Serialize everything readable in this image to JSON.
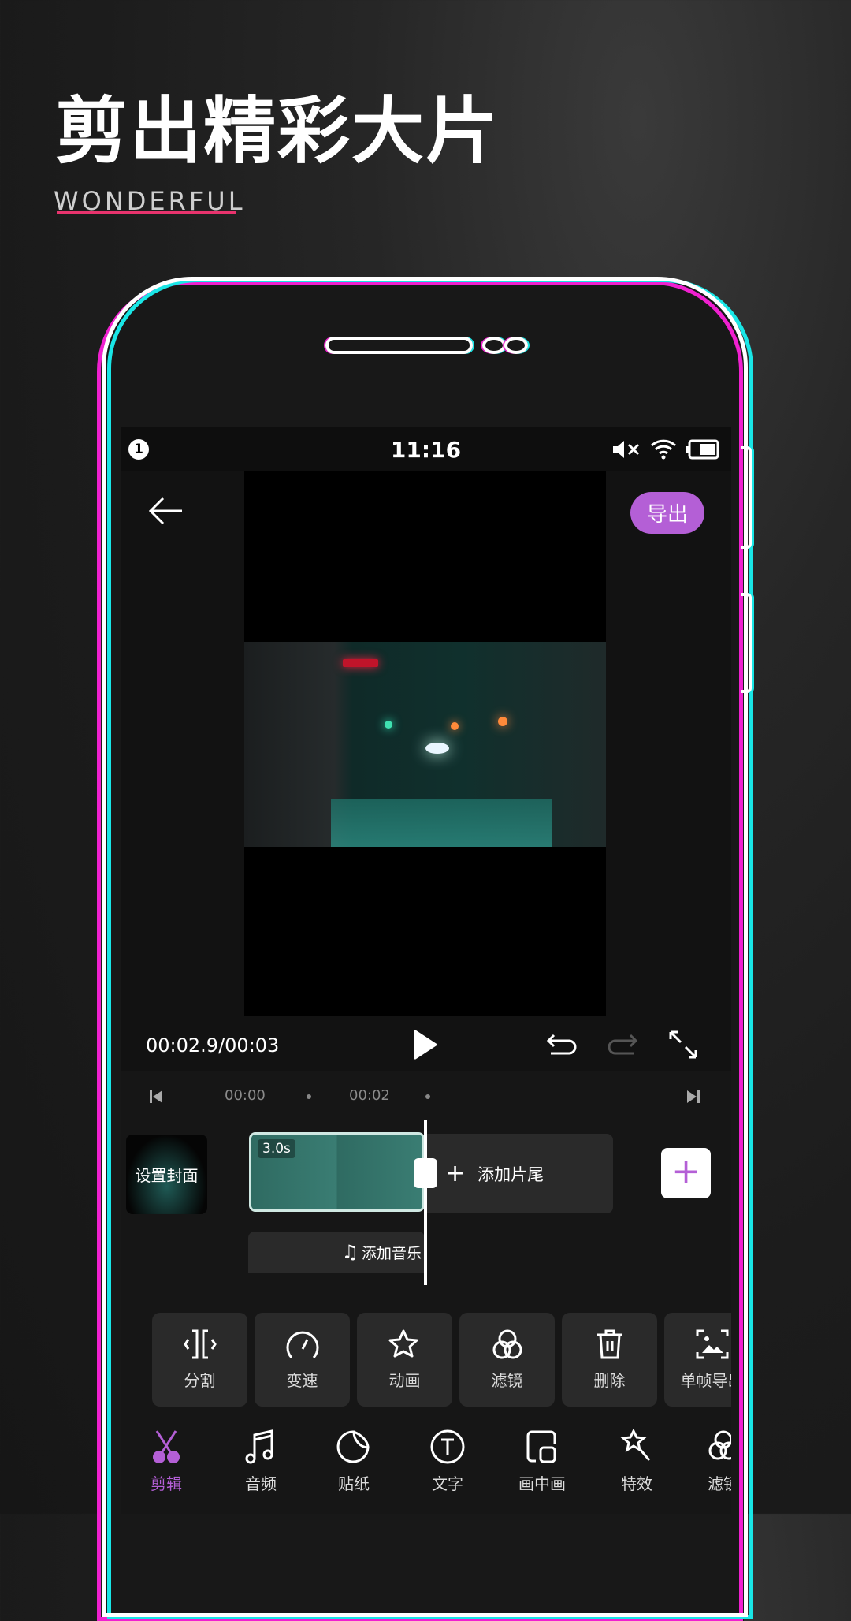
{
  "headline": {
    "title": "剪出精彩大片",
    "subtitle": "WONDERFUL"
  },
  "colors": {
    "accent": "#b45fd6",
    "underline": "#e8336d",
    "frame_cyan": "#19e6e6",
    "frame_magenta": "#f020d0",
    "clip": "#2f6b62"
  },
  "status_bar": {
    "time": "11:16",
    "notification_badge": "1",
    "icons": [
      "mute-icon",
      "wifi-icon",
      "battery-icon"
    ]
  },
  "editor": {
    "back_icon": "arrow-left-icon",
    "export_label": "导出",
    "timecode": "00:02.9/00:03",
    "controls": [
      "play-icon",
      "undo-icon",
      "redo-icon",
      "fullscreen-icon"
    ]
  },
  "timeline": {
    "ticks": [
      "00:00",
      "00:02"
    ],
    "cover_label": "设置封面",
    "clip_duration": "3.0s",
    "add_ending_label": "添加片尾",
    "add_music_label": "添加音乐"
  },
  "tools": [
    {
      "label": "分割",
      "icon": "split-icon"
    },
    {
      "label": "变速",
      "icon": "speed-icon"
    },
    {
      "label": "动画",
      "icon": "animation-star-icon"
    },
    {
      "label": "滤镜",
      "icon": "filter-icon"
    },
    {
      "label": "删除",
      "icon": "trash-icon"
    },
    {
      "label": "单帧导出",
      "icon": "frame-export-icon"
    }
  ],
  "nav": [
    {
      "label": "剪辑",
      "icon": "scissors-icon",
      "active": true
    },
    {
      "label": "音频",
      "icon": "music-note-icon"
    },
    {
      "label": "贴纸",
      "icon": "sticker-icon"
    },
    {
      "label": "文字",
      "icon": "text-icon"
    },
    {
      "label": "画中画",
      "icon": "pip-icon"
    },
    {
      "label": "特效",
      "icon": "effects-wand-icon"
    },
    {
      "label": "滤镜",
      "icon": "filter-icon"
    }
  ]
}
